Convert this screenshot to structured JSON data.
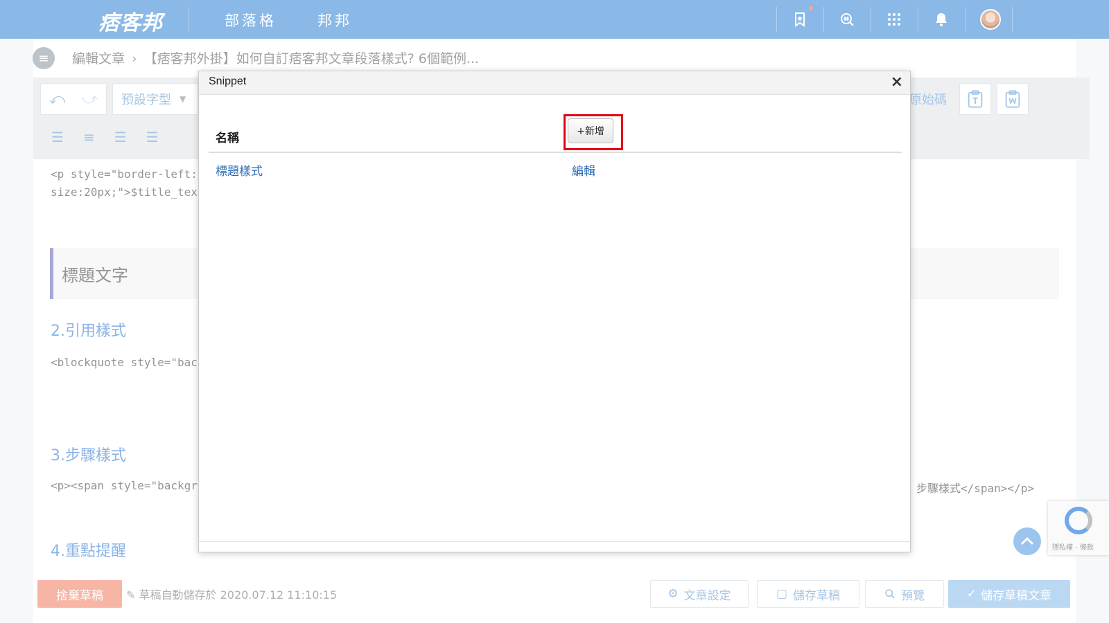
{
  "nav": {
    "logo": "痞客邦",
    "links": [
      "部落格",
      "邦邦"
    ]
  },
  "breadcrumb": {
    "parent": "編輯文章",
    "current": "【痞客邦外掛】如何自訂痞客邦文章段落樣式? 6個範例..."
  },
  "toolbar": {
    "font_label": "預設字型",
    "source_label": "原始碼"
  },
  "content": {
    "code_line_1": "<p style=\"border-left:",
    "code_line_2": "size:20px;\">$title_tex",
    "heading_text": "標題文字",
    "section_2": "2.引用樣式",
    "code_section_2": "<blockquote style=\"bac",
    "section_3": "3.步驟樣式",
    "code_section_3": "<p><span style=\"backgr",
    "code_section_3_tail": "步驟樣式</span></p>",
    "section_4": "4.重點提醒"
  },
  "modal": {
    "title": "Snippet",
    "close_label": "×",
    "column_name": "名稱",
    "add_label": "+新增",
    "rows": [
      {
        "name": "標題樣式",
        "action": "編輯"
      }
    ]
  },
  "bottom": {
    "discard_label": "捨棄草稿",
    "autosave_text": "草稿自動儲存於 2020.07.12 11:10:15",
    "settings_label": "文章設定",
    "save_draft_label": "儲存草稿",
    "preview_label": "預覽",
    "publish_label": "儲存草稿文章"
  },
  "recaptcha": {
    "terms": "隱私權 - 條款"
  },
  "colors": {
    "nav_bg": "#6aa5e0",
    "accent_link": "#2d6cb5",
    "highlight": "#e4000f"
  }
}
